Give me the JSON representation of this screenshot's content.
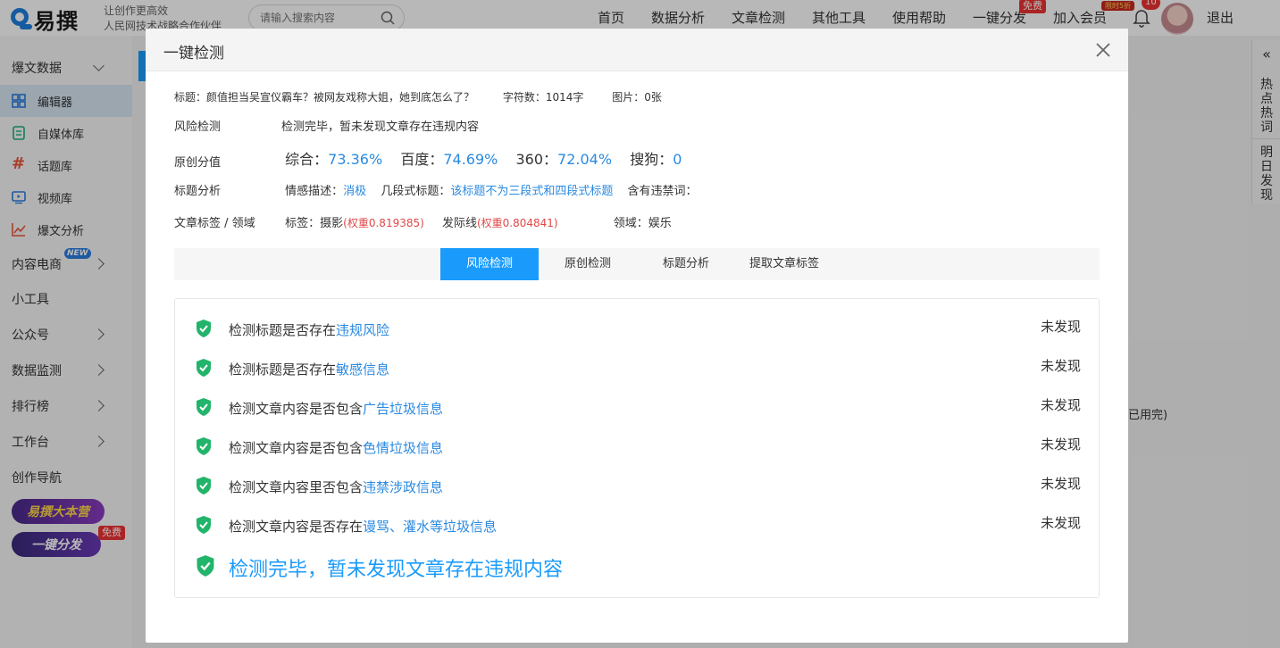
{
  "header": {
    "logo_text": "易撰",
    "slogan_line1": "让创作更高效",
    "slogan_line2": "人民网技术战略合作伙伴",
    "search_placeholder": "请输入搜索内容",
    "nav": [
      "首页",
      "数据分析",
      "文章检测",
      "其他工具",
      "使用帮助",
      "一键分发",
      "加入会员",
      "退出"
    ],
    "free_badge": "免费",
    "discount_badge": "限时5折",
    "notification_count": "10"
  },
  "sidebar": {
    "section_baowen": "爆文数据",
    "sub_items": [
      "编辑器",
      "自媒体库",
      "话题库",
      "视频库",
      "爆文分析"
    ],
    "items": [
      "内容电商",
      "小工具",
      "公众号",
      "数据监测",
      "排行榜",
      "工作台",
      "创作导航"
    ],
    "new_badge": "NEW",
    "promo1": "易撰大本营",
    "promo2": "一键分发",
    "promo2_badge": "免费"
  },
  "right_strip": {
    "tab1": "热点热词",
    "tab2": "明日发现",
    "collapse_icon": "double-chevron-left-icon"
  },
  "background_fragment": "已用完)",
  "modal": {
    "title": "一键检测",
    "meta": {
      "title_label": "标题：",
      "title_value": "颜值担当吴宣仪霸车？被网友戏称大姐，她到底怎么了？",
      "chars_label": "字符数：",
      "chars_value": "1014字",
      "images_label": "图片：",
      "images_value": "0张"
    },
    "risk": {
      "label": "风险检测",
      "value": "检测完毕，暂未发现文章存在违规内容"
    },
    "originality": {
      "label": "原创分值",
      "composite_label": "综合：",
      "composite_value": "73.36%",
      "baidu_label": "百度：",
      "baidu_value": "74.69%",
      "s360_label": "360：",
      "s360_value": "72.04%",
      "sogou_label": "搜狗：",
      "sogou_value": "0"
    },
    "title_analysis": {
      "label": "标题分析",
      "sentiment_label": "情感描述：",
      "sentiment_value": "消极",
      "segment_label": "几段式标题：",
      "segment_value": "该标题不为三段式和四段式标题",
      "banned_label": "含有违禁词："
    },
    "tags": {
      "label": "文章标签 / 领域",
      "tags_label": "标签：",
      "tag1": "摄影",
      "tag1_weight": "(权重0.819385)",
      "tag2": "发际线",
      "tag2_weight": "(权重0.804841)",
      "domain_label": "领域：",
      "domain_value": "娱乐"
    },
    "tabs": [
      "风险检测",
      "原创检测",
      "标题分析",
      "提取文章标签"
    ],
    "active_tab": "风险检测",
    "checks": [
      {
        "prefix": "检测标题是否存在",
        "highlight": "违规风险",
        "status": "未发现"
      },
      {
        "prefix": "检测标题是否存在",
        "highlight": "敏感信息",
        "status": "未发现"
      },
      {
        "prefix": "检测文章内容是否包含",
        "highlight": "广告垃圾信息",
        "status": "未发现"
      },
      {
        "prefix": "检测文章内容是否包含",
        "highlight": "色情垃圾信息",
        "status": "未发现"
      },
      {
        "prefix": "检测文章内容里否包含",
        "highlight": "违禁涉政信息",
        "status": "未发现"
      },
      {
        "prefix": "检测文章内容是否存在",
        "highlight": "谩骂、灌水等垃圾信息",
        "status": "未发现"
      }
    ],
    "final_message": "检测完毕，暂未发现文章存在违规内容"
  },
  "colors": {
    "accent": "#1a9bfc",
    "link_blue": "#2a8ae0",
    "shield_green": "#22b46a",
    "weight_red": "#e04848"
  }
}
